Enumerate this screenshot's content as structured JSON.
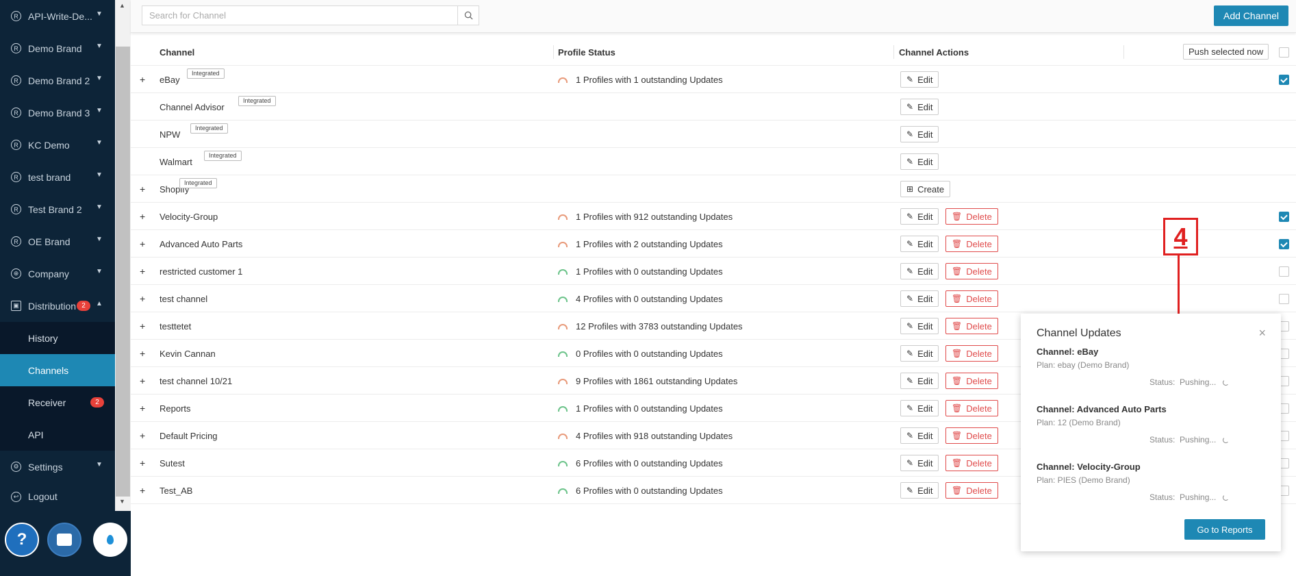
{
  "sidebar": {
    "items": [
      {
        "label": "API-Write-De...",
        "icon": "registered-icon"
      },
      {
        "label": "Demo Brand",
        "icon": "registered-icon"
      },
      {
        "label": "Demo Brand 2",
        "icon": "registered-icon"
      },
      {
        "label": "Demo Brand 3",
        "icon": "registered-icon"
      },
      {
        "label": "KC Demo",
        "icon": "registered-icon"
      },
      {
        "label": "test brand",
        "icon": "registered-icon"
      },
      {
        "label": "Test Brand 2",
        "icon": "registered-icon"
      },
      {
        "label": "OE Brand",
        "icon": "registered-icon"
      },
      {
        "label": "Company",
        "icon": "globe-icon"
      }
    ],
    "distribution": {
      "label": "Distribution",
      "badge": "2"
    },
    "sub_items": [
      {
        "label": "History"
      },
      {
        "label": "Channels"
      },
      {
        "label": "Receiver",
        "badge": "2"
      },
      {
        "label": "API"
      }
    ],
    "settings": {
      "label": "Settings"
    },
    "logout": {
      "label": "Logout"
    },
    "help_glyph": "?"
  },
  "topbar": {
    "search_placeholder": "Search for Channel",
    "add_channel": "Add Channel"
  },
  "table": {
    "headers": {
      "channel": "Channel",
      "profile_status": "Profile Status",
      "channel_actions": "Channel Actions",
      "push": "Push selected now"
    },
    "rows": [
      {
        "expand": "+",
        "name": "eBay",
        "tag": "Integrated",
        "status": "1 Profiles with 1 outstanding Updates",
        "status_color": "#e89a7a",
        "edit": "Edit",
        "checked": true
      },
      {
        "name": "Channel Advisor",
        "tag": "Integrated",
        "edit": "Edit"
      },
      {
        "name": "NPW",
        "tag": "Integrated",
        "edit": "Edit"
      },
      {
        "name": "Walmart",
        "tag": "Integrated",
        "edit": "Edit"
      },
      {
        "expand": "+",
        "name": "Shopify",
        "tag": "Integrated",
        "create": "Create"
      },
      {
        "expand": "+",
        "name": "Velocity-Group",
        "status": "1 Profiles with 912 outstanding Updates",
        "edit": "Edit",
        "delete": "Delete",
        "checked": true
      },
      {
        "expand": "+",
        "name": "Advanced Auto Parts",
        "status": "1 Profiles with 2 outstanding Updates",
        "edit": "Edit",
        "delete": "Delete",
        "checked": true
      },
      {
        "expand": "+",
        "name": "restricted customer 1",
        "status": "1 Profiles with 0 outstanding Updates",
        "edit": "Edit",
        "delete": "Delete",
        "checked": false
      },
      {
        "expand": "+",
        "name": "test channel",
        "status": "4 Profiles with 0 outstanding Updates",
        "edit": "Edit",
        "delete": "Delete",
        "checked": false
      },
      {
        "expand": "+",
        "name": "testtetet",
        "status": "12 Profiles with 3783 outstanding Updates",
        "edit": "Edit",
        "delete": "Delete",
        "checked": false
      },
      {
        "expand": "+",
        "name": "Kevin Cannan",
        "status": "0 Profiles with 0 outstanding Updates",
        "edit": "Edit",
        "delete": "Delete",
        "checked": false
      },
      {
        "expand": "+",
        "name": "test channel 10/21",
        "status": "9 Profiles with 1861 outstanding Updates",
        "edit": "Edit",
        "delete": "Delete",
        "checked": false
      },
      {
        "expand": "+",
        "name": "Reports",
        "status": "1 Profiles with 0 outstanding Updates",
        "edit": "Edit",
        "delete": "Delete",
        "checked": false
      },
      {
        "expand": "+",
        "name": "Default Pricing",
        "status": "4 Profiles with 918 outstanding Updates",
        "edit": "Edit",
        "delete": "Delete",
        "checked": false
      },
      {
        "expand": "+",
        "name": "Sutest",
        "status": "6 Profiles with 0 outstanding Updates",
        "edit": "Edit",
        "delete": "Delete",
        "checked": false
      },
      {
        "expand": "+",
        "name": "Test_AB",
        "status": "6 Profiles with 0 outstanding Updates",
        "edit": "Edit",
        "delete": "Delete",
        "checked": false
      }
    ]
  },
  "annotation": {
    "number": "4",
    "color": "#e02020"
  },
  "popover": {
    "title": "Channel Updates",
    "close": "×",
    "updates": [
      {
        "channel": "Channel: eBay",
        "plan": "Plan: ebay (Demo Brand)",
        "status": "Status:  Pushing..."
      },
      {
        "channel": "Channel: Advanced Auto Parts",
        "plan": "Plan: 12 (Demo Brand)",
        "status": "Status:  Pushing..."
      },
      {
        "channel": "Channel: Velocity-Group",
        "plan": "Plan: PIES (Demo Brand)",
        "status": "Status:  Pushing..."
      }
    ],
    "go_to_reports": "Go to Reports"
  },
  "colors": {
    "accent": "#1e88b4",
    "sidebar_bg": "#0d2438",
    "danger": "#e04b4b",
    "status_orange": "#e89a7a",
    "status_green": "#6cc38a"
  }
}
